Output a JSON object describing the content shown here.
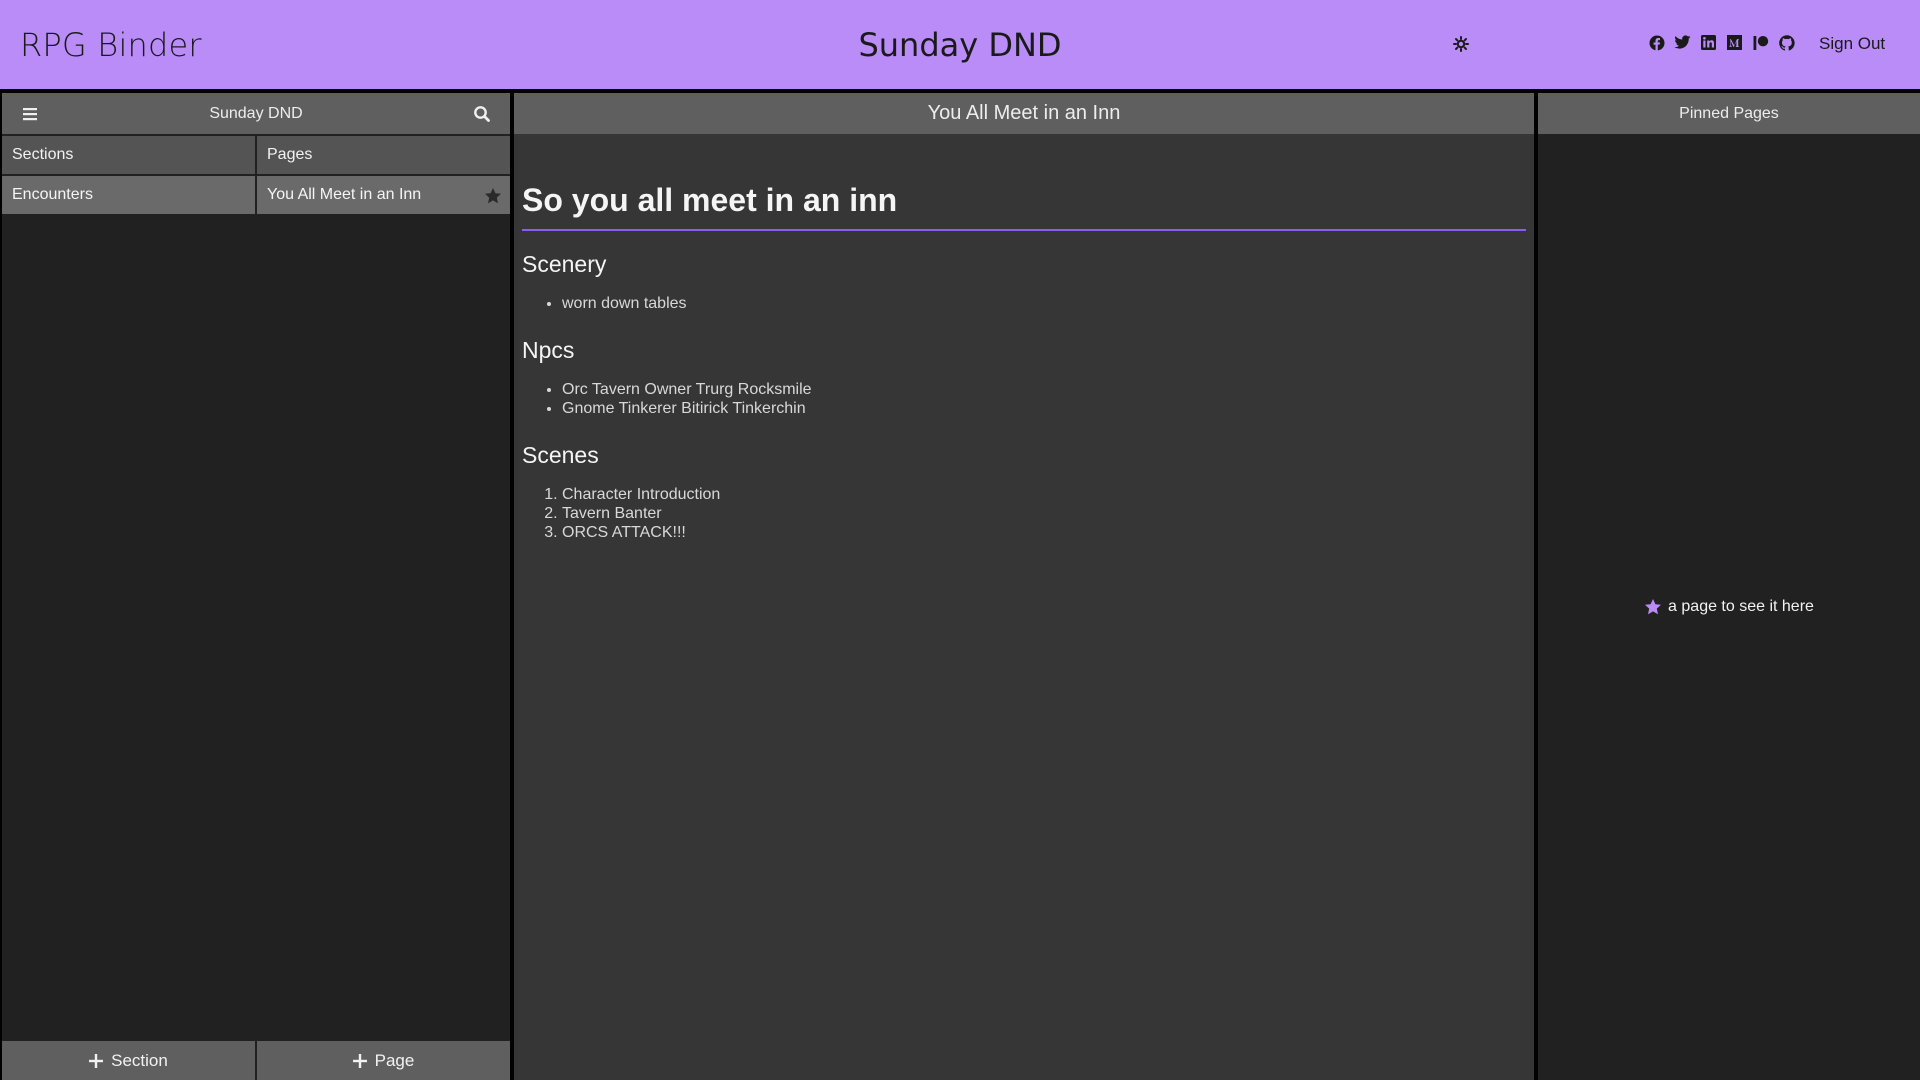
{
  "header": {
    "brand": "RPG Binder",
    "campaign_title": "Sunday DND",
    "sign_out_label": "Sign Out",
    "theme_icon": "gear-icon",
    "social_icons": [
      "facebook-icon",
      "twitter-icon",
      "linkedin-icon",
      "medium-icon",
      "patreon-icon",
      "github-icon"
    ]
  },
  "sidebar": {
    "title": "Sunday DND",
    "sections_header": "Sections",
    "pages_header": "Pages",
    "sections": [
      {
        "label": "Encounters"
      }
    ],
    "pages": [
      {
        "label": "You All Meet in an Inn"
      }
    ],
    "add_section_label": "Section",
    "add_page_label": "Page"
  },
  "main": {
    "page_title": "You All Meet in an Inn",
    "heading": "So you all meet in an inn",
    "scenery_heading": "Scenery",
    "scenery_items": [
      "worn down tables"
    ],
    "npcs_heading": "Npcs",
    "npc_items": [
      "Orc Tavern Owner Trurg Rocksmile",
      "Gnome Tinkerer Bitirick Tinkerchin"
    ],
    "scenes_heading": "Scenes",
    "scene_items": [
      "Character Introduction",
      "Tavern Banter",
      "ORCS ATTACK!!!"
    ]
  },
  "pinned": {
    "title": "Pinned Pages",
    "empty_hint": "a page to see it here"
  },
  "colors": {
    "accent": "#b98cf8",
    "rule": "#8a5cf0",
    "panel_bg": "#212121",
    "content_bg": "#363636",
    "bar_bg": "#5f5f5f"
  }
}
